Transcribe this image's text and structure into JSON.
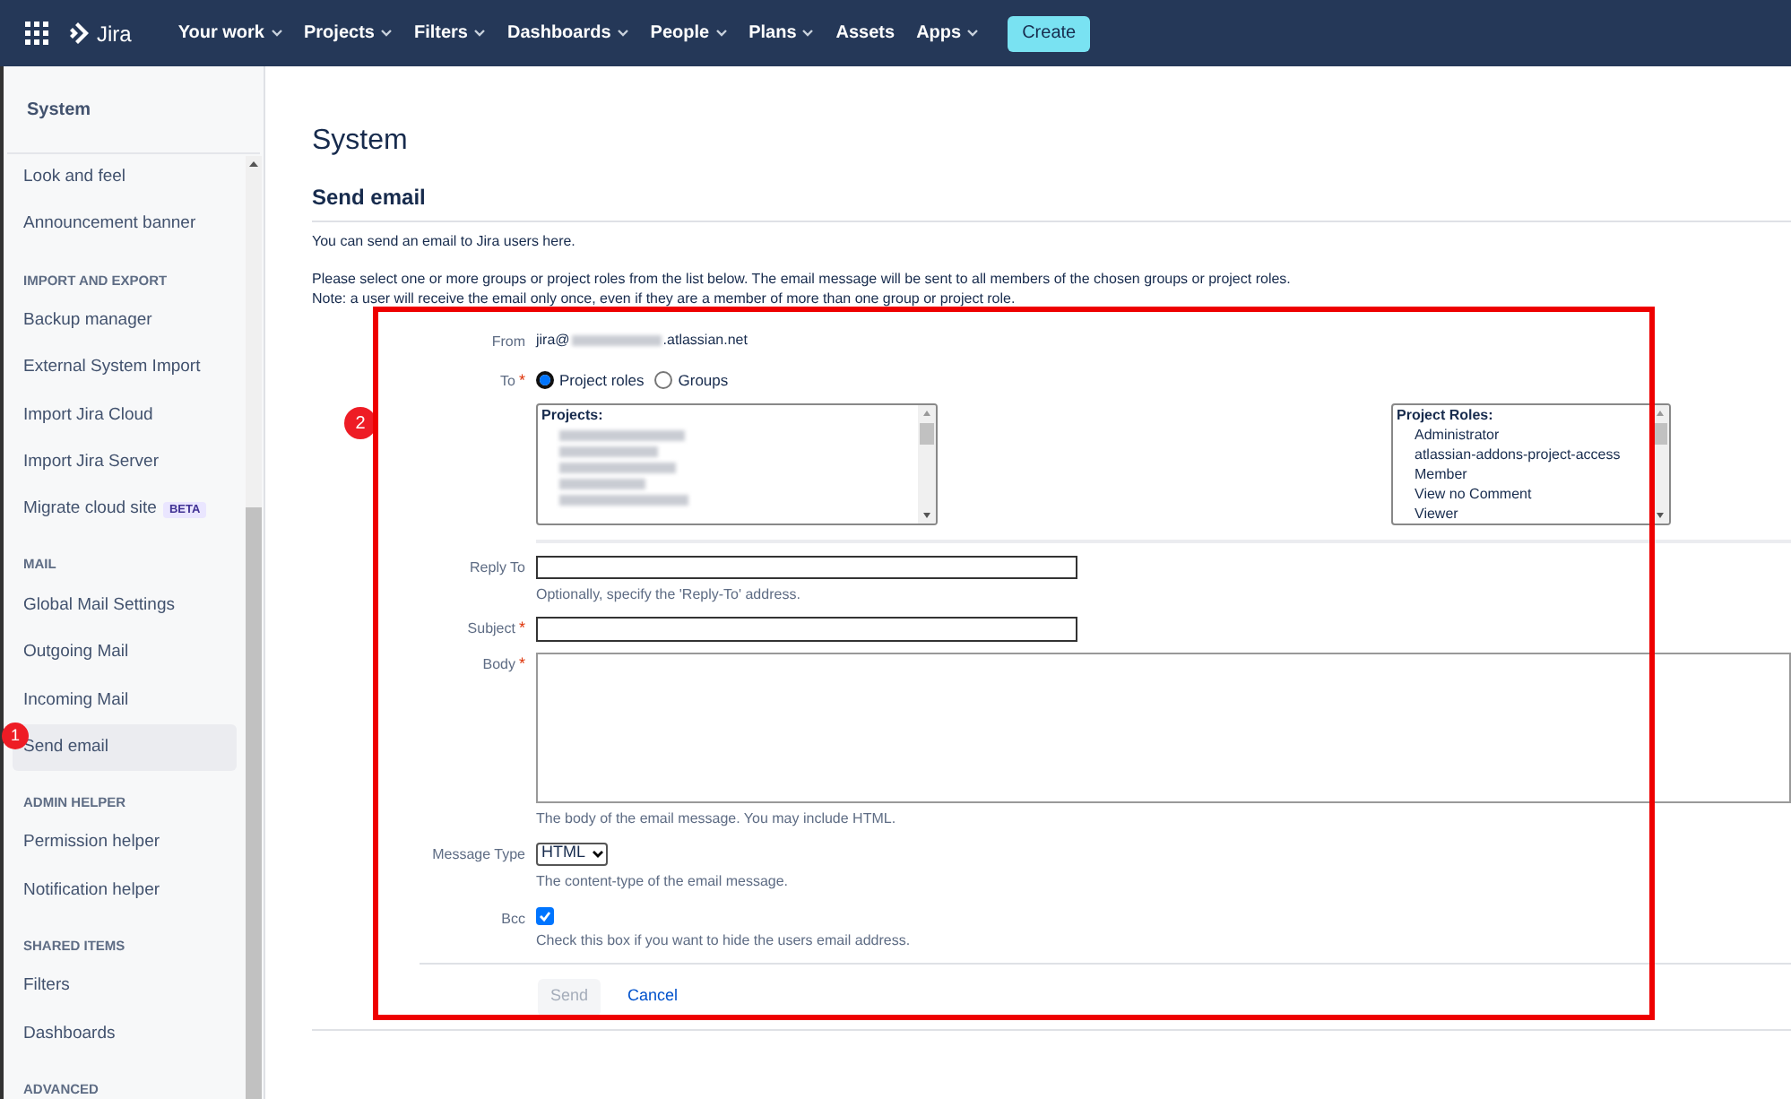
{
  "topnav": {
    "product": "Jira",
    "items": [
      {
        "label": "Your work",
        "dropdown": true
      },
      {
        "label": "Projects",
        "dropdown": true
      },
      {
        "label": "Filters",
        "dropdown": true
      },
      {
        "label": "Dashboards",
        "dropdown": true
      },
      {
        "label": "People",
        "dropdown": true
      },
      {
        "label": "Plans",
        "dropdown": true
      },
      {
        "label": "Assets",
        "dropdown": false
      },
      {
        "label": "Apps",
        "dropdown": true
      }
    ],
    "create": "Create"
  },
  "sidebar": {
    "title": "System",
    "entries": [
      {
        "kind": "item",
        "label": "Look and feel",
        "selected": false
      },
      {
        "kind": "item",
        "label": "Announcement banner",
        "selected": false
      },
      {
        "kind": "heading",
        "label": "IMPORT AND EXPORT"
      },
      {
        "kind": "item",
        "label": "Backup manager",
        "selected": false
      },
      {
        "kind": "item",
        "label": "External System Import",
        "selected": false
      },
      {
        "kind": "item",
        "label": "Import Jira Cloud",
        "selected": false
      },
      {
        "kind": "item",
        "label": "Import Jira Server",
        "selected": false
      },
      {
        "kind": "item",
        "label": "Migrate cloud site",
        "badge": "BETA",
        "selected": false
      },
      {
        "kind": "heading",
        "label": "MAIL"
      },
      {
        "kind": "item",
        "label": "Global Mail Settings",
        "selected": false
      },
      {
        "kind": "item",
        "label": "Outgoing Mail",
        "selected": false
      },
      {
        "kind": "item",
        "label": "Incoming Mail",
        "selected": false
      },
      {
        "kind": "item",
        "label": "Send email",
        "selected": true,
        "marker": "1"
      },
      {
        "kind": "heading",
        "label": "ADMIN HELPER"
      },
      {
        "kind": "item",
        "label": "Permission helper",
        "selected": false
      },
      {
        "kind": "item",
        "label": "Notification helper",
        "selected": false
      },
      {
        "kind": "heading",
        "label": "SHARED ITEMS"
      },
      {
        "kind": "item",
        "label": "Filters",
        "selected": false
      },
      {
        "kind": "item",
        "label": "Dashboards",
        "selected": false
      },
      {
        "kind": "heading",
        "label": "ADVANCED"
      }
    ]
  },
  "page": {
    "title": "System",
    "section": "Send email",
    "intro": "You can send an email to Jira users here.",
    "instructions": [
      "Please select one or more groups or project roles from the list below. The email message will be sent to all members of the chosen groups or project roles.",
      "Note: a user will receive the email only once, even if they are a member of more than one group or project role."
    ]
  },
  "form": {
    "from": {
      "label": "From",
      "prefix": "jira@",
      "suffix": ".atlassian.net"
    },
    "to": {
      "label": "To",
      "required_mark": "*",
      "marker": "2",
      "options": [
        {
          "label": "Project roles",
          "selected": true
        },
        {
          "label": "Groups",
          "selected": false
        }
      ]
    },
    "projects": {
      "heading": "Projects:",
      "items": [
        {
          "kind": "redacted"
        },
        {
          "kind": "redacted"
        },
        {
          "kind": "redacted"
        },
        {
          "kind": "redacted"
        },
        {
          "kind": "redacted"
        }
      ]
    },
    "roles": {
      "heading": "Project Roles:",
      "items": [
        "Administrator",
        "atlassian-addons-project-access",
        "Member",
        "View no Comment",
        "Viewer"
      ]
    },
    "reply_to": {
      "label": "Reply To",
      "help": "Optionally, specify the 'Reply-To' address."
    },
    "subject": {
      "label": "Subject",
      "required_mark": "*"
    },
    "body": {
      "label": "Body",
      "required_mark": "*",
      "help": "The body of the email message. You may include HTML."
    },
    "message_type": {
      "label": "Message Type",
      "value": "HTML",
      "help": "The content-type of the email message."
    },
    "bcc": {
      "label": "Bcc",
      "checked": true,
      "help": "Check this box if you want to hide the users email address."
    },
    "send": "Send",
    "cancel": "Cancel"
  }
}
